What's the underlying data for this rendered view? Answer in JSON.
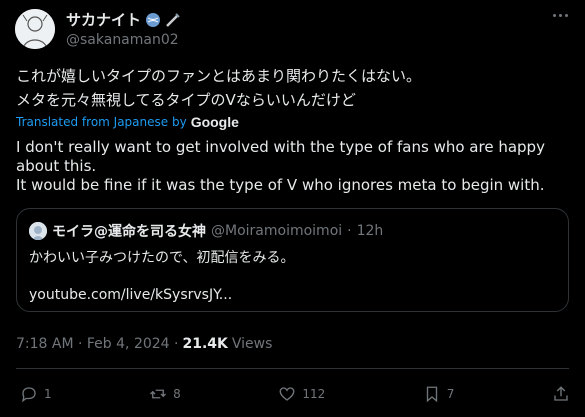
{
  "author": {
    "name": "サカナイト",
    "handle": "@sakanaman02"
  },
  "tweet": {
    "original_text": "これが嬉しいタイプのファンとはあまり関わりたくはない。\nメタを元々無視してるタイプのVならいいんだけど",
    "translated_from": "Translated from Japanese by",
    "translator": "Google",
    "translation": "I don't really want to get involved with the type of fans who are happy about this.\nIt would be fine if it was the type of V who ignores meta to begin with."
  },
  "quote": {
    "name": "モイラ@運命を司る女神",
    "handle": "@Moiramoimoimoi",
    "separator": "·",
    "time": "12h",
    "text": "かわいい子みつけたので、初配信をみる。",
    "link": "youtube.com/live/kSysrvsJY..."
  },
  "meta": {
    "time": "7:18 AM · Feb 4, 2024 ·",
    "views_count": "21.4K",
    "views_label": "Views"
  },
  "actions": {
    "replies": "1",
    "reposts": "8",
    "likes": "112",
    "bookmarks": "7"
  },
  "colors": {
    "background": "#000000",
    "text": "#e7e9ea",
    "muted": "#71767b",
    "link": "#1d9bf0",
    "border": "#2f3336"
  }
}
